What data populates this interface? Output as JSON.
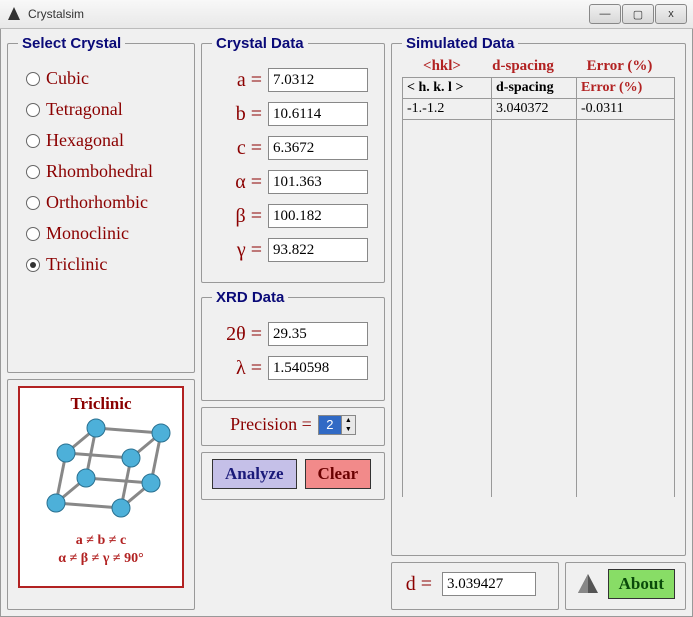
{
  "window": {
    "title": "Crystalsim",
    "min": "—",
    "max": "▢",
    "close": "x"
  },
  "select_crystal": {
    "legend": "Select Crystal",
    "options": [
      "Cubic",
      "Tetragonal",
      "Hexagonal",
      "Rhombohedral",
      "Orthorhombic",
      "Monoclinic",
      "Triclinic"
    ],
    "selected": "Triclinic"
  },
  "crystal_card": {
    "title": "Triclinic",
    "formula1": "a ≠ b ≠ c",
    "formula2": "α ≠ β ≠ γ ≠ 90°"
  },
  "crystal_data": {
    "legend": "Crystal Data",
    "a_label": "a =",
    "a": "7.0312",
    "b_label": "b =",
    "b": "10.6114",
    "c_label": "c =",
    "c": "6.3672",
    "alpha_label": "α =",
    "alpha": "101.363",
    "beta_label": "β =",
    "beta": "100.182",
    "gamma_label": "γ =",
    "gamma": "93.822"
  },
  "xrd_data": {
    "legend": "XRD Data",
    "twotheta_label": "2θ =",
    "twotheta": "29.35",
    "lambda_label": "λ =",
    "lambda": "1.540598"
  },
  "precision": {
    "label": "Precision =",
    "value": "2"
  },
  "buttons": {
    "analyze": "Analyze",
    "clear": "Clear",
    "about": "About"
  },
  "simulated": {
    "legend": "Simulated Data",
    "headers": [
      "<hkl>",
      "d-spacing",
      "Error (%)"
    ],
    "cols": [
      "< h. k. l >",
      "d-spacing",
      "Error (%)"
    ],
    "rows": [
      {
        "hkl": "-1.-1.2",
        "d": "3.040372",
        "err": "-0.0311"
      }
    ]
  },
  "result": {
    "d_label": "d =",
    "d_value": "3.039427"
  }
}
